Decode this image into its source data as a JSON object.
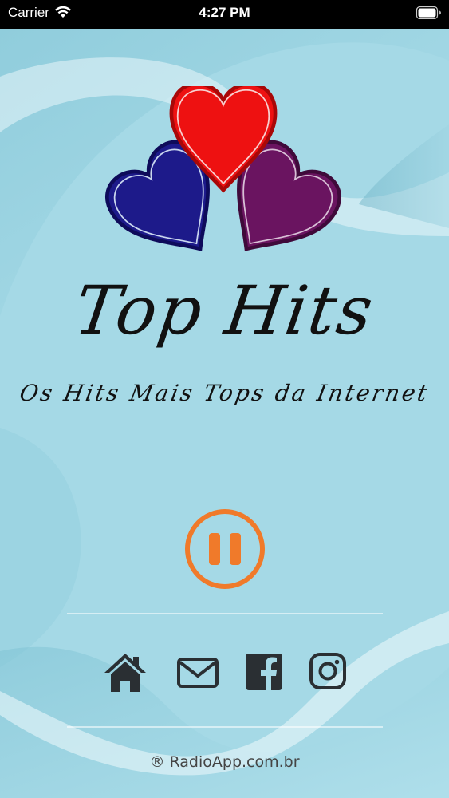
{
  "status_bar": {
    "carrier": "Carrier",
    "time": "4:27 PM",
    "wifi_icon": "wifi-icon",
    "battery_icon": "battery-icon"
  },
  "branding": {
    "title": "Top  Hits",
    "subtitle": "Os Hits Mais Tops da Internet",
    "logo": "three-hearts-logo"
  },
  "colors": {
    "background": "#a5d9e6",
    "heart_red": "#ee1111",
    "heart_blue": "#1f1c8c",
    "heart_purple": "#6a1460",
    "accent_orange": "#f07a2a",
    "icon_dark": "#2a2f33"
  },
  "player": {
    "state": "playing",
    "control_icon": "pause-icon"
  },
  "social": [
    {
      "name": "home",
      "icon": "home-icon"
    },
    {
      "name": "email",
      "icon": "email-icon"
    },
    {
      "name": "facebook",
      "icon": "facebook-icon"
    },
    {
      "name": "instagram",
      "icon": "instagram-icon"
    }
  ],
  "footer": {
    "text": "® RadioApp.com.br"
  }
}
